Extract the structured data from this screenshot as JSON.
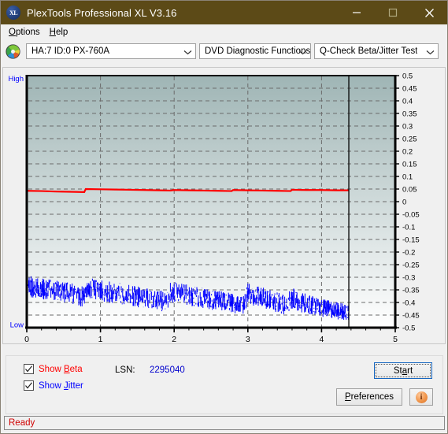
{
  "window": {
    "title": "PlexTools Professional XL V3.16",
    "logo_text": "XL",
    "controls": {
      "minimize": "minimize-icon",
      "maximize": "maximize-icon",
      "close": "close-icon"
    }
  },
  "menubar": {
    "items": [
      {
        "label": "Options",
        "accel": "O"
      },
      {
        "label": "Help",
        "accel": "H"
      }
    ]
  },
  "toolbar": {
    "disc_icon": "disc-icon",
    "drive_select": {
      "value": "HA:7 ID:0  PX-760A"
    },
    "function_select": {
      "value": "DVD Diagnostic Functions"
    },
    "test_select": {
      "value": "Q-Check Beta/Jitter Test"
    }
  },
  "controls": {
    "show_beta": {
      "label_pre": "Show ",
      "label_accel": "B",
      "label_post": "eta",
      "checked": true,
      "color": "#ff0000"
    },
    "show_jitter": {
      "label_pre": "Show ",
      "label_accel": "J",
      "label_post": "itter",
      "checked": true,
      "color": "#0000ff"
    },
    "lsn_label": "LSN:",
    "lsn_value": "2295040",
    "start_button": {
      "pre": "St",
      "accel": "a",
      "post": "rt"
    },
    "preferences_button": {
      "pre": "",
      "accel": "P",
      "post": "references"
    },
    "info_button": "i"
  },
  "statusbar": {
    "text": "Ready"
  },
  "chart_data": {
    "type": "line",
    "title": "",
    "xlabel": "",
    "ylabel": "",
    "xlim": [
      0,
      5
    ],
    "ylim": [
      -0.5,
      0.5
    ],
    "grid": true,
    "legend_position": "below-left",
    "axis_left_top_label": "High",
    "axis_left_bottom_label": "Low",
    "xticks": [
      0,
      1,
      2,
      3,
      4,
      5
    ],
    "xtick_labels": [
      "0",
      "1",
      "2",
      "3",
      "4",
      "5"
    ],
    "yticks": [
      0.5,
      0.45,
      0.4,
      0.35,
      0.3,
      0.25,
      0.2,
      0.15,
      0.1,
      0.05,
      0,
      -0.05,
      -0.1,
      -0.15,
      -0.2,
      -0.25,
      -0.3,
      -0.35,
      -0.4,
      -0.45,
      -0.5
    ],
    "ytick_labels": [
      "0.5",
      "0.45",
      "0.4",
      "0.35",
      "0.3",
      "0.25",
      "0.2",
      "0.15",
      "0.1",
      "0.05",
      "0",
      "-0.05",
      "-0.1",
      "-0.15",
      "-0.2",
      "-0.25",
      "-0.3",
      "-0.35",
      "-0.4",
      "-0.45",
      "-0.5"
    ],
    "data_end_x": 4.37,
    "cursor_x": 4.37,
    "plot_bg_top_color": "#9fb5b5",
    "plot_bg_bottom_color": "#ffffff",
    "series": [
      {
        "name": "Beta",
        "color": "#ff0000",
        "x": [
          0.0,
          0.2,
          0.4,
          0.6,
          0.78,
          0.8,
          1.0,
          1.2,
          1.4,
          1.6,
          1.8,
          1.95,
          2.0,
          2.2,
          2.4,
          2.6,
          2.78,
          2.8,
          3.0,
          3.2,
          3.4,
          3.58,
          3.6,
          3.8,
          4.0,
          4.2,
          4.37
        ],
        "values": [
          0.043,
          0.042,
          0.04,
          0.039,
          0.038,
          0.05,
          0.049,
          0.048,
          0.047,
          0.046,
          0.045,
          0.044,
          0.046,
          0.045,
          0.044,
          0.043,
          0.042,
          0.046,
          0.045,
          0.044,
          0.043,
          0.042,
          0.047,
          0.046,
          0.046,
          0.045,
          0.045
        ]
      },
      {
        "name": "Jitter",
        "color": "#0000ff",
        "band_upper_x": [
          0.0,
          0.3,
          0.6,
          0.78,
          0.8,
          1.1,
          1.4,
          1.7,
          1.9,
          1.95,
          2.2,
          2.5,
          2.8,
          2.95,
          3.0,
          3.3,
          3.5,
          3.62,
          3.7,
          4.0,
          4.2,
          4.37
        ],
        "band_upper": [
          -0.295,
          -0.31,
          -0.325,
          -0.34,
          -0.3,
          -0.318,
          -0.332,
          -0.348,
          -0.358,
          -0.318,
          -0.332,
          -0.35,
          -0.365,
          -0.375,
          -0.325,
          -0.35,
          -0.372,
          -0.345,
          -0.36,
          -0.385,
          -0.4,
          -0.408
        ],
        "band_lower_x": [
          0.0,
          0.3,
          0.6,
          0.78,
          0.8,
          1.1,
          1.4,
          1.7,
          1.9,
          1.95,
          2.2,
          2.5,
          2.8,
          2.95,
          3.0,
          3.3,
          3.5,
          3.62,
          3.7,
          4.0,
          4.2,
          4.37
        ],
        "band_lower": [
          -0.375,
          -0.39,
          -0.402,
          -0.418,
          -0.38,
          -0.398,
          -0.412,
          -0.428,
          -0.438,
          -0.398,
          -0.412,
          -0.428,
          -0.442,
          -0.452,
          -0.405,
          -0.428,
          -0.448,
          -0.422,
          -0.436,
          -0.455,
          -0.465,
          -0.47
        ]
      }
    ]
  }
}
